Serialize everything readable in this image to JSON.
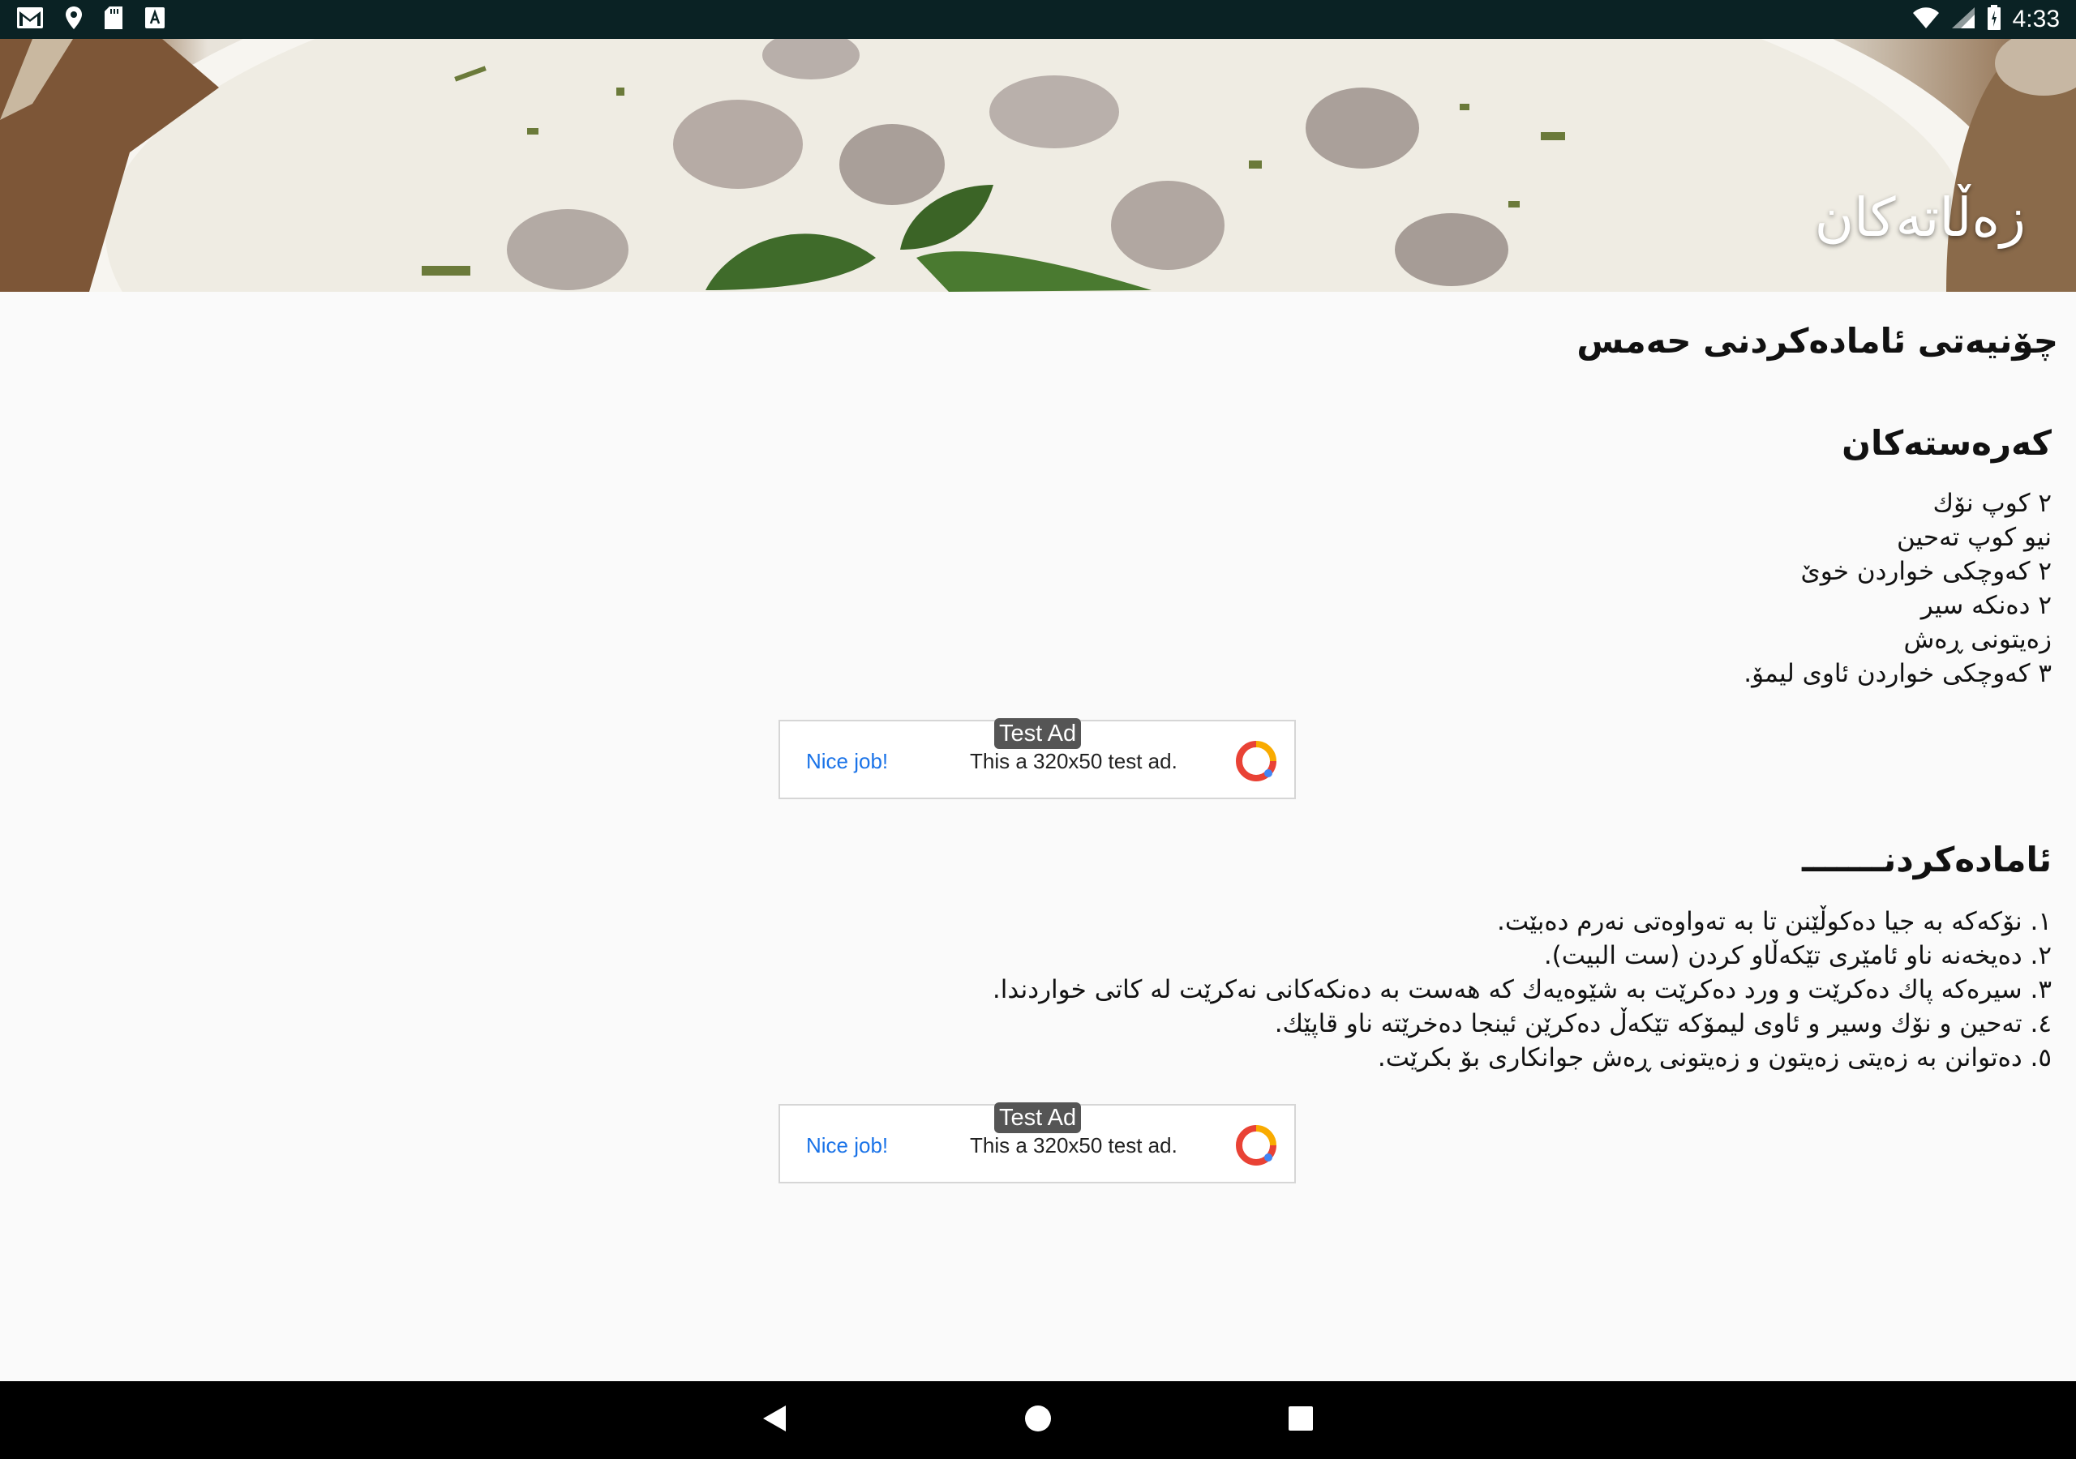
{
  "status_bar": {
    "time": "4:33",
    "left_icons": [
      "gmail-icon",
      "maps-pin-icon",
      "sd-card-icon",
      "a-badge-icon"
    ],
    "right_icons": [
      "wifi-icon",
      "signal-icon",
      "battery-icon"
    ]
  },
  "header": {
    "title": "زەڵاتەکان"
  },
  "recipe": {
    "title": "چۆنیەتی ئامادەکردنی حەمس",
    "ingredients": {
      "heading": "کەرەستەکان",
      "items": [
        "٢ کوپ نۆك",
        "نیو کوپ تەحین",
        "٢ کەوچکی خواردن خوێ",
        "٢ دەنکە سیر",
        "زەیتونی ڕەش",
        "٣ کەوچکی خواردن ئاوی لیمۆ."
      ]
    },
    "preparation": {
      "heading": "ئامادەکردنـــــــ",
      "steps": [
        "١. نۆکەکە بە جیا دەکوڵێنن تا بە تەواوەتی نەرم دەبێت.",
        "٢. دەیخەنە ناو ئامێری تێکەڵاو کردن (ست البیت).",
        "٣. سیرەکە پاك دەکرێت و ورد دەکرێت بە شێوەیەك کە هەست بە دەنکەکانی نەکرێت لە کاتی خواردندا.",
        "٤. تەحین و نۆك وسیر و ئاوی لیمۆکە تێکەڵ دەکرێن ئینجا دەخرێتە ناو قاپێك.",
        "٥. دەتوانن بە زەیتی زەیتون و زەیتونی ڕەش جوانکاری بۆ بکرێت."
      ]
    }
  },
  "ads": [
    {
      "badge": "Test Ad",
      "cta": "Nice job!",
      "text": "This a 320x50 test ad."
    },
    {
      "badge": "Test Ad",
      "cta": "Nice job!",
      "text": "This a 320x50 test ad."
    }
  ],
  "nav_bar": {
    "buttons": [
      "back-icon",
      "home-icon",
      "recents-icon"
    ]
  }
}
